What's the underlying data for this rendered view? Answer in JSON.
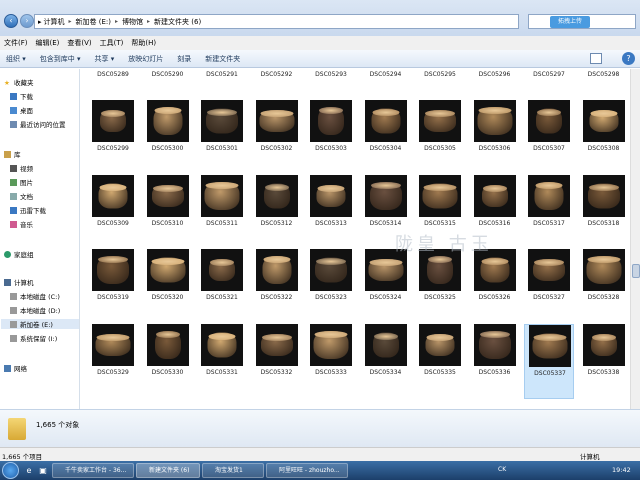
{
  "address": {
    "crumbs": [
      "计算机",
      "新加卷 (E:)",
      "博物馆",
      "新建文件夹 (6)"
    ],
    "search_button": "拓拽上传"
  },
  "menubar": [
    "文件(F)",
    "编辑(E)",
    "查看(V)",
    "工具(T)",
    "帮助(H)"
  ],
  "toolbar": [
    "组织 ▾",
    "包含到库中 ▾",
    "共享 ▾",
    "放映幻灯片",
    "刻录",
    "新建文件夹"
  ],
  "sidebar": {
    "favorites": "收藏夹",
    "fav_items": [
      "下载",
      "桌面",
      "最近访问的位置"
    ],
    "library": "库",
    "lib_items": [
      "视频",
      "图片",
      "文档",
      "迅雷下载",
      "音乐"
    ],
    "homegroup": "家庭组",
    "computer": "计算机",
    "drives": [
      "本地磁盘 (C:)",
      "本地磁盘 (D:)",
      "新加卷 (E:)",
      "系统保留 (I:)"
    ],
    "network": "网络"
  },
  "files": {
    "top_row": [
      "DSC05289",
      "DSC05290",
      "DSC05291",
      "DSC05292",
      "DSC05293",
      "DSC05294",
      "DSC05295",
      "DSC05296",
      "DSC05297",
      "DSC05298"
    ],
    "rows": [
      [
        "DSC05299",
        "DSC05300",
        "DSC05301",
        "DSC05302",
        "DSC05303",
        "DSC05304",
        "DSC05305",
        "DSC05306",
        "DSC05307",
        "DSC05308"
      ],
      [
        "DSC05309",
        "DSC05310",
        "DSC05311",
        "DSC05312",
        "DSC05313",
        "DSC05314",
        "DSC05315",
        "DSC05316",
        "DSC05317",
        "DSC05318"
      ],
      [
        "DSC05319",
        "DSC05320",
        "DSC05321",
        "DSC05322",
        "DSC05323",
        "DSC05324",
        "DSC05325",
        "DSC05326",
        "DSC05327",
        "DSC05328"
      ],
      [
        "DSC05329",
        "DSC05330",
        "DSC05331",
        "DSC05332",
        "DSC05333",
        "DSC05334",
        "DSC05335",
        "DSC05336",
        "DSC05337",
        "DSC05338"
      ]
    ],
    "selected": "DSC05337"
  },
  "watermark": "陇皇  古玉",
  "details": {
    "count": "1,665 个对象"
  },
  "statusbar": {
    "left": "1,665 个项目",
    "right": "计算机"
  },
  "taskbar": {
    "items": [
      "千牛卖家工作台 - 36...",
      "新建文件夹 (6)",
      "淘宝发货1",
      "阿里旺旺 - zhouzho..."
    ],
    "tray": "CK",
    "clock": "19:42"
  },
  "colors": {
    "accent": "#2f6fb8",
    "taskbar": "#1c3f6a",
    "selection": "#cde6fb"
  }
}
